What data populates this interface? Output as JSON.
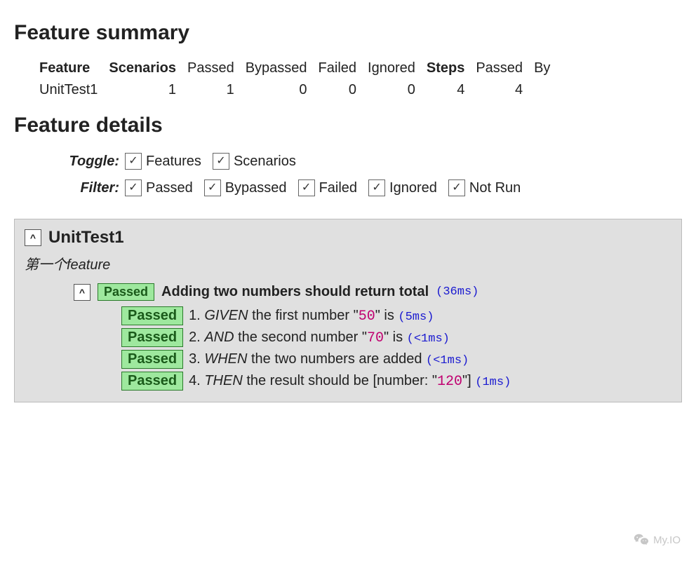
{
  "summary": {
    "heading": "Feature summary",
    "columns": [
      "Feature",
      "Scenarios",
      "Passed",
      "Bypassed",
      "Failed",
      "Ignored",
      "Steps",
      "Passed",
      "By"
    ],
    "columns_strong": [
      true,
      true,
      false,
      false,
      false,
      false,
      true,
      false,
      false
    ],
    "row": [
      "UnitTest1",
      "1",
      "1",
      "0",
      "0",
      "0",
      "4",
      "4",
      ""
    ]
  },
  "details": {
    "heading": "Feature details",
    "toggle_label": "Toggle:",
    "filter_label": "Filter:",
    "toggles": [
      {
        "label": "Features",
        "checked": true
      },
      {
        "label": "Scenarios",
        "checked": true
      }
    ],
    "filters": [
      {
        "label": "Passed",
        "checked": true
      },
      {
        "label": "Bypassed",
        "checked": true
      },
      {
        "label": "Failed",
        "checked": true
      },
      {
        "label": "Ignored",
        "checked": true
      },
      {
        "label": "Not Run",
        "checked": true
      }
    ]
  },
  "feature": {
    "toggle": "^",
    "title": "UnitTest1",
    "description": "第一个feature",
    "scenario": {
      "toggle": "^",
      "status": "Passed",
      "title": "Adding two numbers should return total",
      "time": "(36ms)",
      "steps": [
        {
          "status": "Passed",
          "num": "1.",
          "keyword": "GIVEN",
          "pre": " the first number \"",
          "param": "50",
          "post": "\" is ",
          "time": "(5ms)"
        },
        {
          "status": "Passed",
          "num": "2.",
          "keyword": "AND",
          "pre": " the second number \"",
          "param": "70",
          "post": "\" is ",
          "time": "(<1ms)"
        },
        {
          "status": "Passed",
          "num": "3.",
          "keyword": "WHEN",
          "pre": " the two numbers are added ",
          "param": "",
          "post": "",
          "time": "(<1ms)"
        },
        {
          "status": "Passed",
          "num": "4.",
          "keyword": "THEN",
          "pre": " the result should be [number: \"",
          "param": "120",
          "post": "\"] ",
          "time": "(1ms)"
        }
      ]
    }
  },
  "watermark": "My.IO",
  "checkmark": "✓"
}
